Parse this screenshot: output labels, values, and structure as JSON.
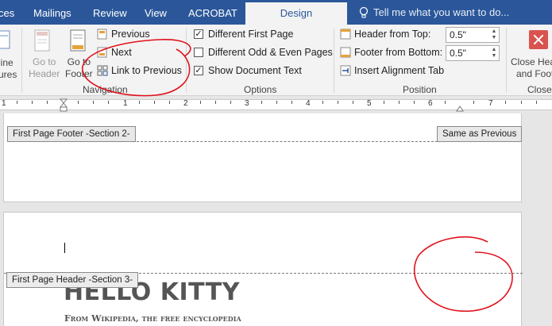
{
  "tabs": [
    {
      "label": "ces",
      "active": false
    },
    {
      "label": "Mailings",
      "active": false
    },
    {
      "label": "Review",
      "active": false
    },
    {
      "label": "View",
      "active": false
    },
    {
      "label": "ACROBAT",
      "active": false
    },
    {
      "label": "Design",
      "active": true
    }
  ],
  "tell_me": "Tell me what you want to do...",
  "ribbon": {
    "insert_group": {
      "partial_label_1": "line",
      "partial_label_2": "ures"
    },
    "navigation": {
      "go_to_header": "Go to\nHeader",
      "go_to_footer": "Go to\nFooter",
      "previous": "Previous",
      "next": "Next",
      "link_to_previous": "Link to Previous",
      "group_label": "Navigation"
    },
    "options": {
      "different_first_page": {
        "label": "Different First Page",
        "checked": true
      },
      "different_odd_even": {
        "label": "Different Odd & Even Pages",
        "checked": false
      },
      "show_document_text": {
        "label": "Show Document Text",
        "checked": true
      },
      "group_label": "Options"
    },
    "position": {
      "header_from_top_label": "Header from Top:",
      "header_from_top_value": "0.5\"",
      "footer_from_bottom_label": "Footer from Bottom:",
      "footer_from_bottom_value": "0.5\"",
      "insert_alignment_tab": "Insert Alignment Tab",
      "group_label": "Position"
    },
    "close": {
      "button_label_1": "Close Hea",
      "button_label_2": "and Foot",
      "group_label": "Close"
    }
  },
  "ruler": {
    "numbers": [
      "1",
      "1",
      "2",
      "3",
      "4",
      "5",
      "6",
      "7"
    ]
  },
  "page1": {
    "footer_tag": "First Page Footer -Section 2-",
    "same_as_previous": "Same as Previous"
  },
  "page2": {
    "header_tag": "First Page Header -Section 3-",
    "title": "HELLO KITTY",
    "subtitle": "From Wikipedia, the free encyclopedia"
  },
  "colors": {
    "ribbon_blue": "#2b579a",
    "annotation_red": "#e0101a"
  }
}
